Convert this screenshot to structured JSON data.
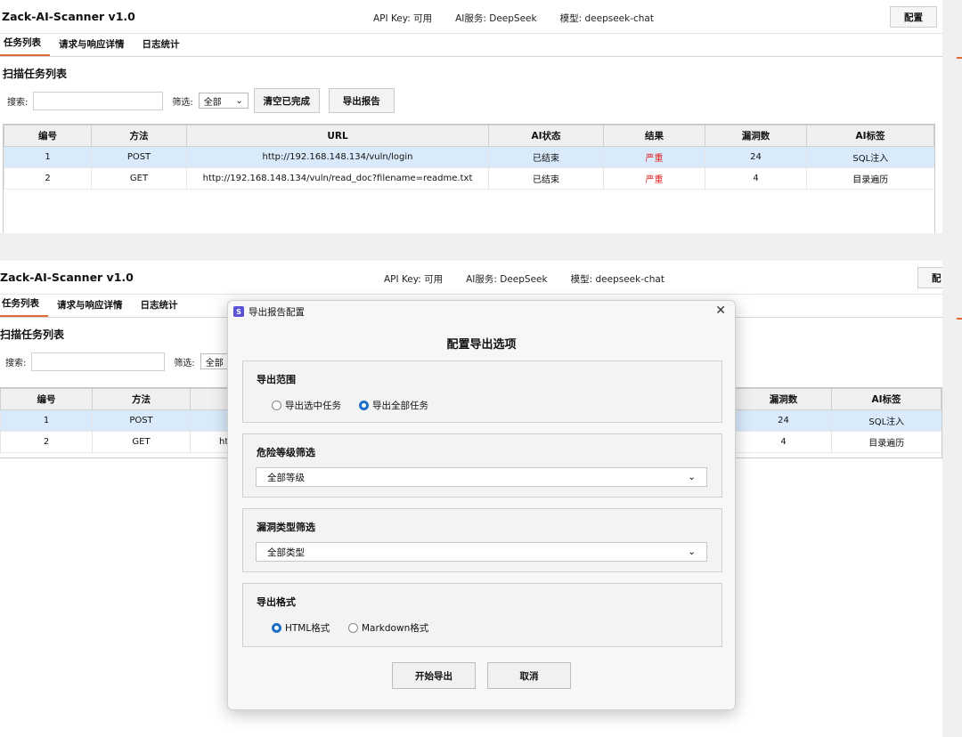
{
  "app": {
    "title": "Zack-AI-Scanner v1.0",
    "api_key": "API Key: 可用",
    "ai_service": "AI服务: DeepSeek",
    "model": "模型: deepseek-chat",
    "config_label": "配置",
    "config_label_cut": "配"
  },
  "tabs": [
    {
      "label": "任务列表"
    },
    {
      "label": "请求与响应详情"
    },
    {
      "label": "日志统计"
    }
  ],
  "section_title": "扫描任务列表",
  "filters": {
    "search_label": "搜索:",
    "filter_label": "筛选:",
    "filter_value": "全部",
    "clear_button": "清空已完成",
    "export_button": "导出报告"
  },
  "table": {
    "headers": [
      "编号",
      "方法",
      "URL",
      "AI状态",
      "结果",
      "漏洞数",
      "AI标签"
    ],
    "rows": [
      {
        "id": "1",
        "method": "POST",
        "url": "http://192.168.148.134/vuln/login",
        "ai_status": "已结束",
        "result": "严重",
        "vuln_count": "24",
        "ai_tag": "SQL注入"
      },
      {
        "id": "2",
        "method": "GET",
        "url": "http://192.168.148.134/vuln/read_doc?filename=readme.txt",
        "ai_status": "已结束",
        "result": "严重",
        "vuln_count": "4",
        "ai_tag": "目录遍历"
      }
    ],
    "cut_url_fragment": "ht"
  },
  "dialog": {
    "window_title": "导出报告配置",
    "heading": "配置导出选项",
    "scope": {
      "title": "导出范围",
      "opt_selected": "导出选中任务",
      "opt_all": "导出全部任务"
    },
    "risk": {
      "title": "危险等级筛选",
      "value": "全部等级"
    },
    "vtype": {
      "title": "漏洞类型筛选",
      "value": "全部类型"
    },
    "format": {
      "title": "导出格式",
      "opt_html": "HTML格式",
      "opt_md": "Markdown格式"
    },
    "start_button": "开始导出",
    "cancel_button": "取消"
  },
  "colors": {
    "accent": "#e0693a",
    "selected_row": "#d9ebfb",
    "severity": "#e02020",
    "radio_on": "#1f6fc6"
  }
}
